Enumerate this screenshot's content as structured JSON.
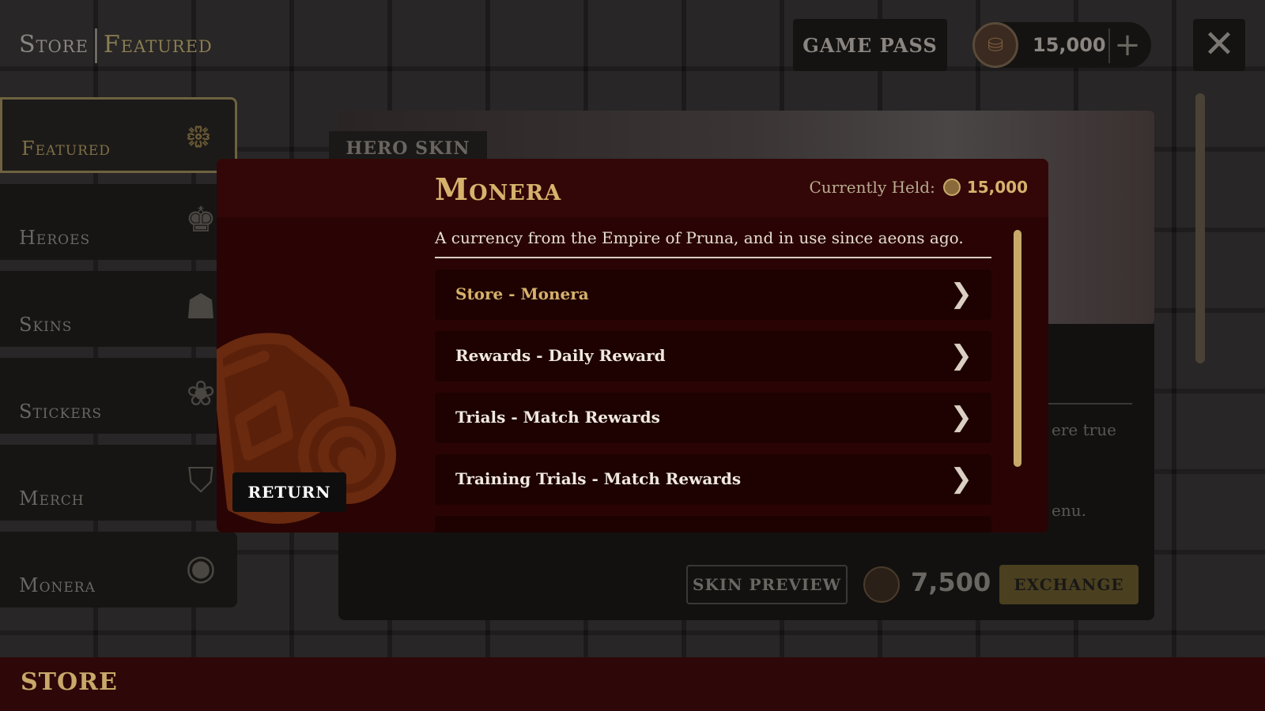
{
  "header": {
    "crumb_root": "Store",
    "crumb_current": "Featured",
    "game_pass": "GAME PASS",
    "currency_amount": "15,000",
    "plus_symbol": "+",
    "close_symbol": "✕"
  },
  "sidebar": {
    "items": [
      {
        "label": "Featured",
        "icon": "spiral-icon",
        "glyph": "᪥",
        "active": true
      },
      {
        "label": "Heroes",
        "icon": "hero-icon",
        "glyph": "♚",
        "active": false
      },
      {
        "label": "Skins",
        "icon": "skin-icon",
        "glyph": "☗",
        "active": false
      },
      {
        "label": "Stickers",
        "icon": "sticker-icon",
        "glyph": "❀",
        "active": false
      },
      {
        "label": "Merch",
        "icon": "merch-icon",
        "glyph": "⛉",
        "active": false
      },
      {
        "label": "Monera",
        "icon": "coin-icon",
        "glyph": "◉",
        "active": false
      }
    ]
  },
  "background": {
    "hero_tab": "HERO SKIN",
    "frag_1": "ere true",
    "frag_2": "enu.",
    "skin_preview": "SKIN PREVIEW",
    "price": "7,500",
    "exchange": "EXCHANGE"
  },
  "modal": {
    "title": "Monera",
    "held_label": "Currently Held:",
    "held_value": "15,000",
    "description": "A currency from the Empire of Pruna, and in use since aeons ago.",
    "sources": [
      {
        "label": "Store - Monera"
      },
      {
        "label": "Rewards - Daily Reward"
      },
      {
        "label": "Trials - Match Rewards"
      },
      {
        "label": "Training Trials - Match Rewards"
      }
    ],
    "return_label": "RETURN"
  },
  "footer": {
    "label": "STORE"
  },
  "colors": {
    "accent_gold": "#d6b26c",
    "modal_bg": "#2a0404",
    "footer_bg": "#2e0808"
  }
}
